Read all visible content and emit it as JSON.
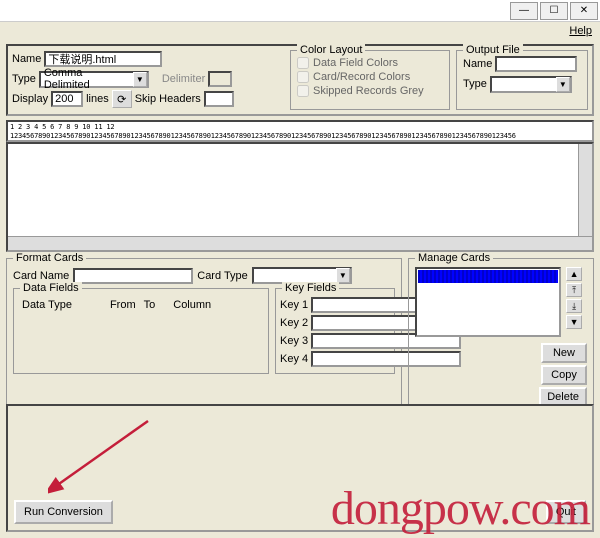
{
  "titlebar": {
    "min": "—",
    "max": "☐",
    "close": "✕"
  },
  "menubar": {
    "help": "Help"
  },
  "controls": {
    "name_label": "Name",
    "name_value": "下载说明.html",
    "type_label": "Type",
    "type_value": "Comma Delimited",
    "delimiter_label": "Delimiter",
    "display_label": "Display",
    "display_value": "200",
    "lines_label": "lines",
    "skip_headers_label": "Skip Headers",
    "skip_value": ""
  },
  "color_layout": {
    "title": "Color Layout",
    "cb1": "Data Field Colors",
    "cb2": "Card/Record Colors",
    "cb3": "Skipped Records Grey"
  },
  "output_file": {
    "title": "Output File",
    "name_label": "Name",
    "name_value": "",
    "type_label": "Type",
    "type_value": ""
  },
  "ruler": {
    "nums": "       1         2         3         4         5         6         7         8         9        10        11        12",
    "ticks": "123456789012345678901234567890123456789012345678901234567890123456789012345678901234567890123456789012345678901234567890123456"
  },
  "format_cards": {
    "title": "Format Cards",
    "card_name_label": "Card Name",
    "card_name_value": "",
    "card_type_label": "Card Type",
    "card_type_value": ""
  },
  "data_fields": {
    "title": "Data Fields",
    "col1": "Data Type",
    "col2": "From",
    "col3": "To",
    "col4": "Column"
  },
  "key_fields": {
    "title": "Key Fields",
    "k1": "Key 1",
    "k2": "Key 2",
    "k3": "Key 3",
    "k4": "Key 4"
  },
  "manage_cards": {
    "title": "Manage Cards",
    "new": "New",
    "copy": "Copy",
    "delete": "Delete"
  },
  "bottom": {
    "run": "Run Conversion",
    "quit": "Quit"
  },
  "watermark": "dongpow.com"
}
